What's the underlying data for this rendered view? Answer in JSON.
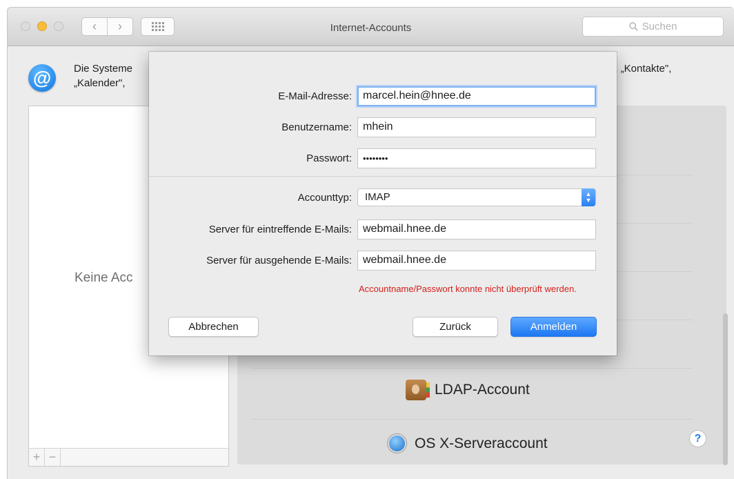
{
  "window": {
    "title": "Internet-Accounts",
    "search_placeholder": "Suchen",
    "nav_back": "‹",
    "nav_forward": "›"
  },
  "header": {
    "text_left_line1": "Die Systeme",
    "text_left_line2": "„Kalender\",",
    "text_right_line1": "ail\", „Kontakte\","
  },
  "left_panel": {
    "empty_text": "Keine Acc",
    "add_label": "+",
    "remove_label": "−"
  },
  "right_panel": {
    "providers": [
      {
        "label": "LDAP-Account",
        "icon": "address-book-icon"
      },
      {
        "label": "OS X-Serveraccount",
        "icon": "globe-icon"
      }
    ],
    "help_label": "?"
  },
  "dialog": {
    "email_label": "E-Mail-Adresse:",
    "email_value": "marcel.hein@hnee.de",
    "username_label": "Benutzername:",
    "username_value": "mhein",
    "password_label": "Passwort:",
    "password_value": "••••••••",
    "account_type_label": "Accounttyp:",
    "account_type_value": "IMAP",
    "incoming_label": "Server für eintreffende E-Mails:",
    "incoming_value": "webmail.hnee.de",
    "outgoing_label": "Server für ausgehende E-Mails:",
    "outgoing_value": "webmail.hnee.de",
    "error_text": "Accountname/Passwort konnte nicht überprüft werden.",
    "cancel_label": "Abbrechen",
    "back_label": "Zurück",
    "signin_label": "Anmelden"
  },
  "colors": {
    "accent": "#1d77f2",
    "error": "#d4201b"
  }
}
